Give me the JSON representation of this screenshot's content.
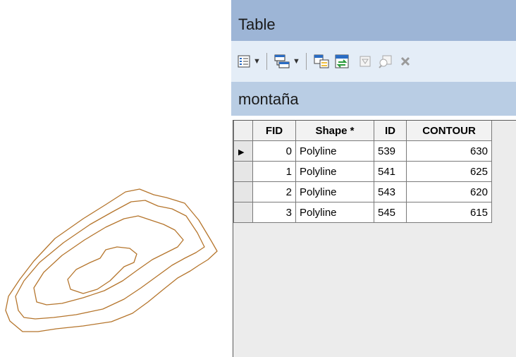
{
  "window": {
    "title": "Table"
  },
  "toolbar": {
    "buttons": [
      {
        "name": "table-options",
        "icon": "table-options-icon"
      },
      {
        "name": "related-tables",
        "icon": "related-tables-icon"
      },
      {
        "name": "select-by-attributes",
        "icon": "select-by-attributes-icon"
      },
      {
        "name": "switch-selection",
        "icon": "switch-selection-icon"
      },
      {
        "name": "clear-selection",
        "icon": "clear-selection-icon"
      },
      {
        "name": "zoom-to-selected",
        "icon": "zoom-to-selected-icon"
      },
      {
        "name": "delete-selected",
        "icon": "delete-icon"
      }
    ]
  },
  "tab": {
    "label": "montaña"
  },
  "table": {
    "columns": [
      "FID",
      "Shape *",
      "ID",
      "CONTOUR"
    ],
    "rows": [
      {
        "fid": "0",
        "shape": "Polyline",
        "id": "539",
        "contour": "630",
        "current": true
      },
      {
        "fid": "1",
        "shape": "Polyline",
        "id": "541",
        "contour": "625"
      },
      {
        "fid": "2",
        "shape": "Polyline",
        "id": "543",
        "contour": "620"
      },
      {
        "fid": "3",
        "shape": "Polyline",
        "id": "545",
        "contour": "615"
      }
    ]
  },
  "colors": {
    "contour": "#b5752c",
    "titlebar": "#9db5d6",
    "toolbar": "#e4edf7",
    "tabrow": "#b9cde4"
  }
}
